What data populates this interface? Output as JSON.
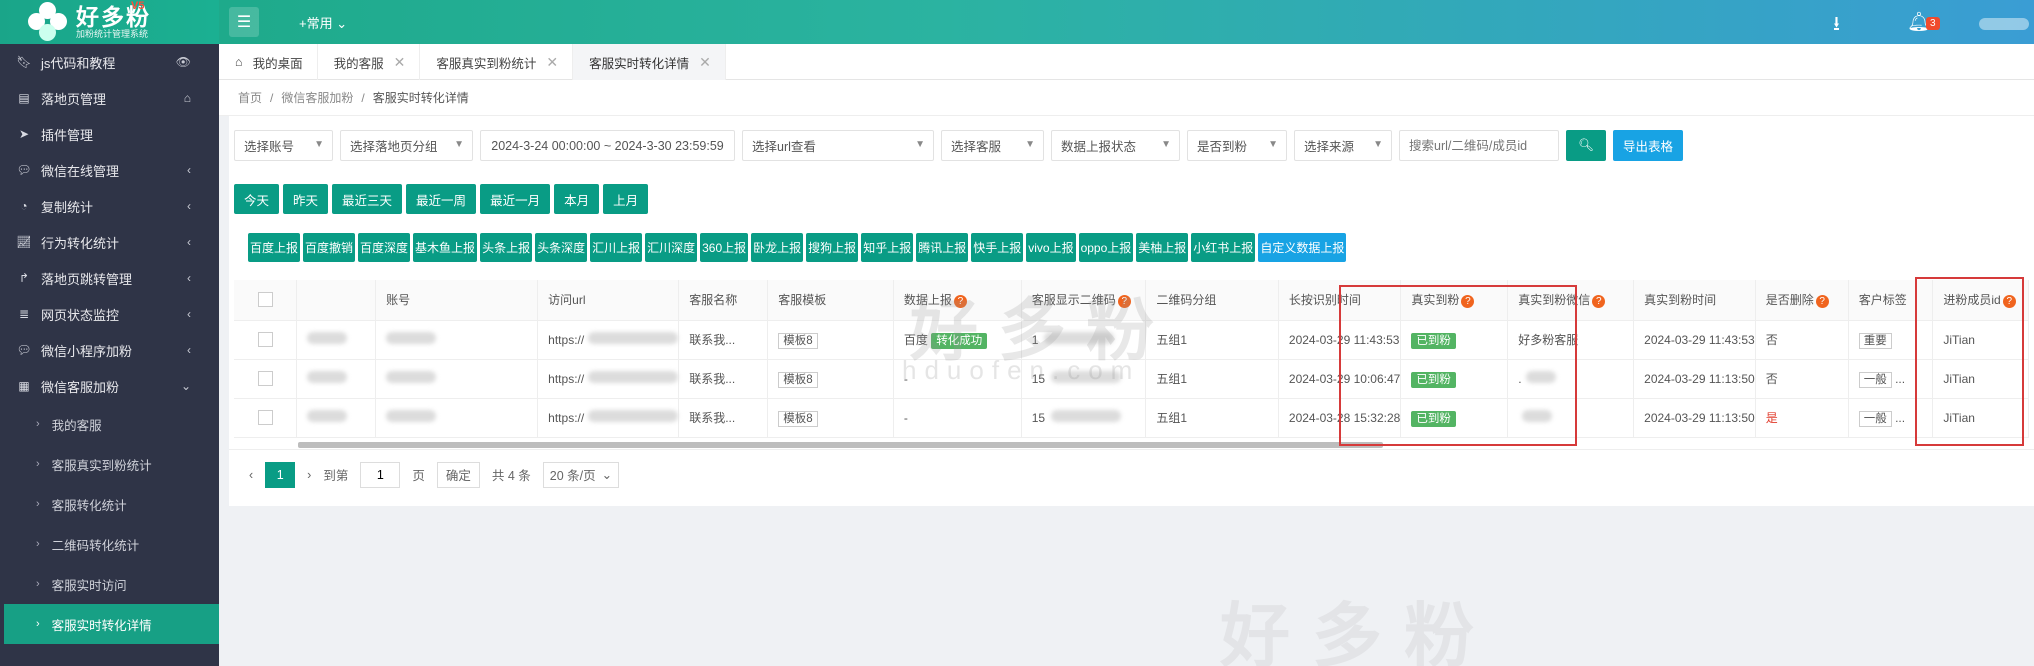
{
  "brand": {
    "name": "好多粉",
    "sub": "加粉统计管理系统",
    "version": "V5"
  },
  "colors": {
    "primary": "#099c85",
    "blue": "#18a3e4",
    "sidebar": "#2f3447",
    "highlight": "#d63a3a",
    "badge": "#f04b2d"
  },
  "topbar": {
    "common": "+常用",
    "badge": "3",
    "icons": [
      "menu-icon",
      "download-icon",
      "bell-icon"
    ]
  },
  "sidebar": {
    "items": [
      {
        "label": "js代码和教程",
        "icon": "bookmark-icon",
        "right": "eye-icon"
      },
      {
        "label": "落地页管理",
        "icon": "page-icon",
        "right": "home-icon"
      },
      {
        "label": "插件管理",
        "icon": "send-icon"
      },
      {
        "label": "微信在线管理",
        "icon": "wechat-icon",
        "chev": true
      },
      {
        "label": "复制统计",
        "icon": "pie-icon",
        "chev": true
      },
      {
        "label": "行为转化统计",
        "icon": "line-chart-icon",
        "chev": true
      },
      {
        "label": "落地页跳转管理",
        "icon": "share-icon",
        "chev": true
      },
      {
        "label": "网页状态监控",
        "icon": "server-icon",
        "chev": true
      },
      {
        "label": "微信小程序加粉",
        "icon": "wechat-icon",
        "chev": true
      },
      {
        "label": "微信客服加粉",
        "icon": "grid-icon",
        "chev": true
      }
    ],
    "sub": [
      "我的客服",
      "客服真实到粉统计",
      "客服转化统计",
      "二维码转化统计",
      "客服实时访问",
      "客服实时转化详情"
    ]
  },
  "tabs": [
    {
      "label": "我的桌面",
      "icon": true
    },
    {
      "label": "我的客服",
      "close": true
    },
    {
      "label": "客服真实到粉统计",
      "close": true
    },
    {
      "label": "客服实时转化详情",
      "close": true,
      "active": true
    }
  ],
  "breadcrumb": [
    "首页",
    "微信客服加粉",
    "客服实时转化详情"
  ],
  "filters": {
    "account": "选择账号",
    "group": "选择落地页分组",
    "daterange": "2024-3-24 00:00:00 ~ 2024-3-30 23:59:59",
    "url": "选择url查看",
    "kefu": "选择客服",
    "report_status": "数据上报状态",
    "arrived": "是否到粉",
    "source": "选择来源",
    "search_placeholder": "搜索url/二维码/成员id",
    "export": "导出表格"
  },
  "quick": [
    "今天",
    "昨天",
    "最近三天",
    "最近一周",
    "最近一月",
    "本月",
    "上月"
  ],
  "reports": [
    "百度上报",
    "百度撤销",
    "百度深度",
    "基木鱼上报",
    "头条上报",
    "头条深度",
    "汇川上报",
    "汇川深度",
    "360上报",
    "卧龙上报",
    "搜狗上报",
    "知乎上报",
    "腾讯上报",
    "快手上报",
    "vivo上报",
    "oppo上报",
    "美柚上报",
    "小红书上报",
    "自定义数据上报"
  ],
  "table": {
    "headers": [
      "账号",
      "访问url",
      "客服名称",
      "客服模板",
      "数据上报",
      "客服显示二维码",
      "二维码分组",
      "长按识别时间",
      "真实到粉",
      "真实到粉微信",
      "真实到粉时间",
      "是否删除",
      "客户标签",
      "进粉成员id"
    ],
    "rows": [
      {
        "url": "https://",
        "name": "联系我...",
        "tpl": "模板8",
        "report": "百度",
        "report_tag": "转化成功",
        "qr": "1",
        "group": "五组1",
        "time": "2024-03-29 11:43:53",
        "arrived": "已到粉",
        "wx": "好多粉客服",
        "atime": "2024-03-29 11:43:53",
        "deleted": "否",
        "label": "重要",
        "label_more": "",
        "member": "JiTian"
      },
      {
        "url": "https://",
        "name": "联系我...",
        "tpl": "模板8",
        "report": "-",
        "report_tag": "",
        "qr": "15",
        "group": "五组1",
        "time": "2024-03-29 10:06:47",
        "arrived": "已到粉",
        "wx": ".",
        "atime": "2024-03-29 11:13:50",
        "deleted": "否",
        "label": "一般",
        "label_more": "...",
        "member": "JiTian"
      },
      {
        "url": "https://",
        "name": "联系我...",
        "tpl": "模板8",
        "report": "-",
        "report_tag": "",
        "qr": "15",
        "group": "五组1",
        "time": "2024-03-28 15:32:28",
        "arrived": "已到粉",
        "wx": "",
        "atime": "2024-03-29 11:13:50",
        "deleted": "是",
        "label": "一般",
        "label_more": "...",
        "member": "JiTian"
      }
    ]
  },
  "pager": {
    "page": "1",
    "goto": "到第",
    "goto_value": "1",
    "page_unit": "页",
    "confirm": "确定",
    "total": "共 4 条",
    "size": "20 条/页"
  },
  "watermark": {
    "cn": "好多粉",
    "en": "hduofen.com"
  }
}
